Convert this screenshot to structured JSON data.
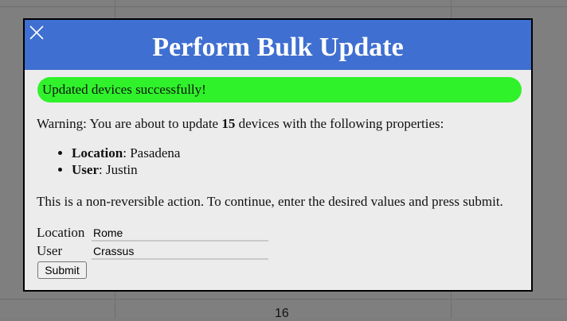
{
  "background": {
    "cell_number": "16"
  },
  "modal": {
    "title": "Perform Bulk Update",
    "close_icon": "close-icon",
    "success_message": "Updated devices successfully!",
    "warning_prefix": "Warning: You are about to update ",
    "device_count": "15",
    "warning_suffix": " devices with the following properties:",
    "properties": [
      {
        "key": "Location",
        "value": ": Pasadena"
      },
      {
        "key": "User",
        "value": ": Justin"
      }
    ],
    "note": "This is a non-reversible action. To continue, enter the desired values and press submit.",
    "form": {
      "location_label": "Location",
      "location_value": "Rome",
      "user_label": "User",
      "user_value": "Crassus",
      "submit_label": "Submit"
    }
  },
  "colors": {
    "header": "#3f6fd1",
    "success": "#2ff22a",
    "modal_bg": "#ececec",
    "backdrop": "#7f7f7f"
  }
}
